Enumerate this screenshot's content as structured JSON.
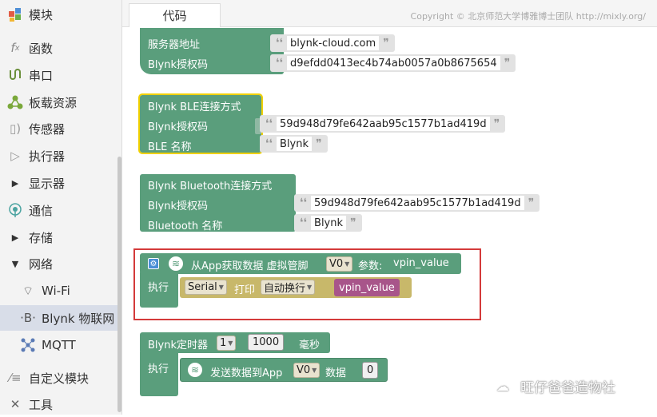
{
  "sidebar": {
    "items": [
      {
        "label": "模块",
        "icon": "puzzle-icon"
      },
      {
        "label": "函数",
        "icon": "function-icon"
      },
      {
        "label": "串口",
        "icon": "serial-port-icon"
      },
      {
        "label": "板载资源",
        "icon": "board-resource-icon"
      },
      {
        "label": "传感器",
        "icon": "sensor-icon"
      },
      {
        "label": "执行器",
        "icon": "actuator-icon"
      },
      {
        "label": "显示器",
        "icon": "expand-triangle-icon"
      },
      {
        "label": "通信",
        "icon": "communication-icon"
      },
      {
        "label": "存储",
        "icon": "expand-triangle-icon"
      },
      {
        "label": "网络",
        "icon": "collapse-triangle-icon"
      },
      {
        "label": "Wi-Fi",
        "icon": "wifi-icon"
      },
      {
        "label": "Blynk 物联网",
        "icon": "bluetooth-b-icon"
      },
      {
        "label": "MQTT",
        "icon": "mqtt-icon"
      },
      {
        "label": "自定义模块",
        "icon": "custom-module-icon"
      },
      {
        "label": "工具",
        "icon": "tools-icon"
      }
    ]
  },
  "tabs": {
    "code": "代码"
  },
  "copyright": "Copyright © 北京师范大学博雅博士团队 http://mixly.org/",
  "blocks": {
    "server": {
      "server_label": "服务器地址",
      "server_value": "blynk-cloud.com",
      "auth_label": "Blynk授权码",
      "auth_value": "d9efdd0413ec4b74ab0057a0b8675654"
    },
    "ble": {
      "title": "Blynk BLE连接方式",
      "auth_label": "Blynk授权码",
      "auth_value": "59d948d79fe642aab95c1577b1ad419d",
      "name_label": "BLE 名称",
      "name_value": "Blynk"
    },
    "bluetooth": {
      "title": "Blynk Bluetooth连接方式",
      "auth_label": "Blynk授权码",
      "auth_value": "59d948d79fe642aab95c1577b1ad419d",
      "name_label": "Bluetooth 名称",
      "name_value": "Blynk"
    },
    "app_read": {
      "title": "从App获取数据 虚拟管脚",
      "pin": "V0",
      "param_label": "参数:",
      "param_value": "vpin_value",
      "exec_label": "执行",
      "serial": "Serial",
      "print": "打印",
      "newline": "自动换行",
      "print_var": "vpin_value"
    },
    "timer": {
      "title": "Blynk定时器",
      "index": "1",
      "interval": "1000",
      "unit": "毫秒",
      "exec_label": "执行",
      "send_label": "发送数据到App",
      "pin": "V0",
      "data_label": "数据",
      "data_value": "0"
    }
  },
  "watermark": "旺仔爸爸造物社"
}
